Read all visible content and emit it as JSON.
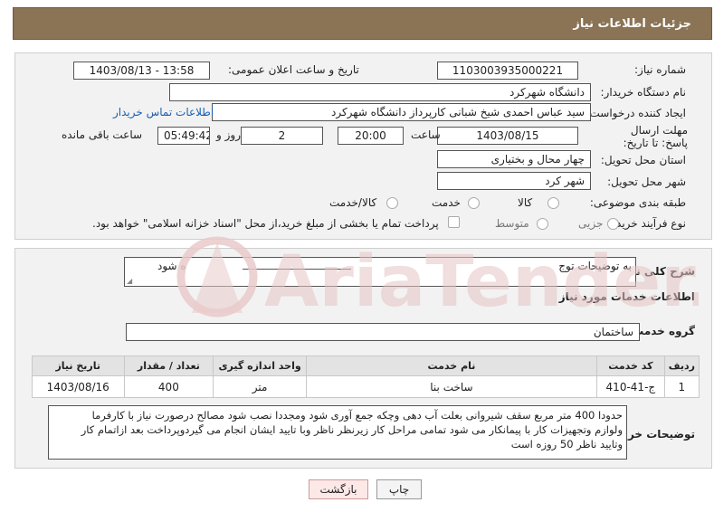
{
  "header": {
    "title": "جزئیات اطلاعات نیاز"
  },
  "fields": {
    "need_number_label": "شماره نیاز:",
    "need_number": "1103003935000221",
    "announce_label": "تاریخ و ساعت اعلان عمومی:",
    "announce_value": "1403/08/13 - 13:58",
    "buyer_org_label": "نام دستگاه خریدار:",
    "buyer_org": "دانشگاه شهرکرد",
    "requester_label": "ایجاد کننده درخواست:",
    "requester": "سید عباس احمدی شیخ شبانی کارپرداز دانشگاه شهرکرد",
    "buyer_contact_link": "اطلاعات تماس خریدار",
    "deadline_label": "مهلت ارسال پاسخ: تا تاریخ:",
    "deadline_date": "1403/08/15",
    "time_label": "ساعت",
    "deadline_time": "20:00",
    "days_value": "2",
    "days_label": "روز و",
    "remaining_time": "05:49:42",
    "remaining_label": "ساعت باقی مانده",
    "province_label": "استان محل تحویل:",
    "province": "چهار محال و بختیاری",
    "city_label": "شهر محل تحویل:",
    "city": "شهر کرد",
    "category_label": "طبقه بندی موضوعی:",
    "category_options": [
      "کالا",
      "خدمت",
      "کالا/خدمت"
    ],
    "category_selected": "خدمت",
    "process_label": "نوع فرآیند خرید :",
    "process_options": [
      "جزیی",
      "متوسط"
    ],
    "payment_note": "پرداخت تمام یا بخشی از مبلغ خرید،از محل \"اسناد خزانه اسلامی\" خواهد بود."
  },
  "summary": {
    "label": "شرح کلی نیاز:",
    "value_left": "ه شود",
    "value_right": "به توضیحات توج"
  },
  "services": {
    "section_title": "اطلاعات خدمات مورد نیاز",
    "group_label": "گروه خدمت:",
    "group_value": "ساختمان",
    "columns": [
      "ردیف",
      "کد خدمت",
      "نام خدمت",
      "واحد اندازه گیری",
      "تعداد / مقدار",
      "تاریخ نیاز"
    ],
    "rows": [
      {
        "row": "1",
        "code": "ج-41-410",
        "name": "ساخت بنا",
        "unit": "متر",
        "qty": "400",
        "date": "1403/08/16"
      }
    ]
  },
  "buyer_notes": {
    "label": "توضیحات خریدار:",
    "line1": "حدودا 400 متر مربع سقف شیروانی بعلت آب دهی وچکه  جمع آوری شود ومجددا نصب شود مصالح درصورت نیاز با کارفرما",
    "line2": "ولوازم وتجهیزات کار با پیمانکار می شود تمامی مراحل کار زیرنظر ناظر وبا تایید ایشان انجام می گیردوپرداخت بعد ازاتمام کار",
    "line3": "وتایید ناظر 50 روزه است"
  },
  "buttons": {
    "print": "چاپ",
    "back": "بازگشت"
  },
  "watermark": {
    "text": "AriaTender.neT"
  },
  "colors": {
    "header_bg": "#8b7355",
    "link": "#1a5fb4",
    "back_bg": "#fde8e8",
    "watermark": "#e8c8c8"
  }
}
